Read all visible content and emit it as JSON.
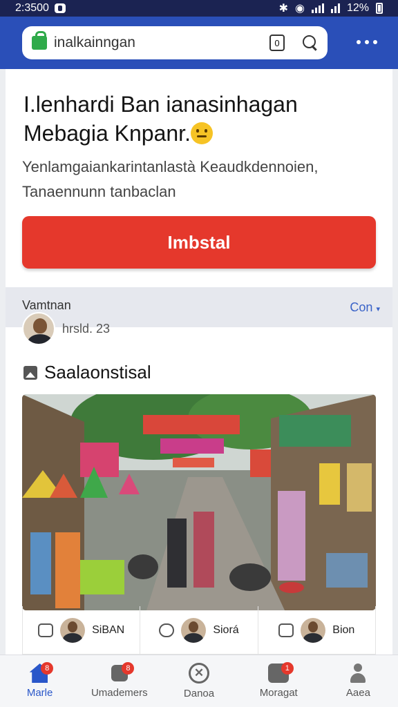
{
  "status_bar": {
    "time": "2:3500",
    "battery": "12%"
  },
  "browser": {
    "url_text": "inalkainngan",
    "tab_count": "0"
  },
  "article": {
    "headline": "I.lenhardi Ban ianasinhagan Mebagia Knpanr.",
    "subtitle": "Yenlamgaiankarintanlastà Keaudkdennoien, Tanaennunn tanbaclan",
    "install_label": "Imbstal"
  },
  "section": {
    "label": "Vamtnan",
    "dropdown": "Con"
  },
  "author": {
    "name": "hrsld. 23"
  },
  "gallery": {
    "title": "Saalaonstisal"
  },
  "actions": [
    {
      "label": "SiBAN"
    },
    {
      "label": "Siorá"
    },
    {
      "label": "Bion"
    }
  ],
  "bottom_nav": [
    {
      "label": "Marle",
      "badge": "8",
      "icon": "home-icon"
    },
    {
      "label": "Umademers",
      "badge": "8",
      "icon": "people-icon"
    },
    {
      "label": "Danoa",
      "icon": "close-circle-icon"
    },
    {
      "label": "Moragat",
      "badge": "1",
      "icon": "message-icon"
    },
    {
      "label": "Aaea",
      "icon": "profile-icon"
    }
  ],
  "colors": {
    "app_bar": "#2a4fb8",
    "status_bar": "#1b2352",
    "install_button": "#e5382c",
    "accent": "#2a57c9"
  }
}
